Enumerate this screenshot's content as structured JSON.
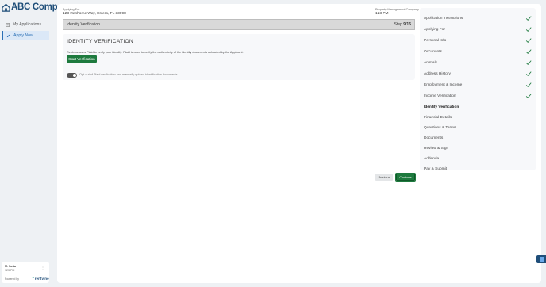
{
  "brand": {
    "logo_text": "ABC Company",
    "accent": "#1f4e79",
    "green": "#1e7a3e"
  },
  "sidebar": {
    "items": [
      {
        "label": "My Applications",
        "icon": "document-icon",
        "active": false
      },
      {
        "label": "Apply Now",
        "icon": "pencil-icon",
        "active": true
      }
    ],
    "user": {
      "name": "M. Sofia",
      "address": "123 PM"
    },
    "powered_by": "Powered by",
    "powered_logo": "rentvine"
  },
  "header": {
    "applying_for_label": "Applying For",
    "applying_for_value": "123 Renhome Way, Estero, FL 33098",
    "company_label": "Property Management Company",
    "company_value": "123 PM"
  },
  "step_bar": {
    "title": "Identity Verification",
    "step_prefix": "Step",
    "step_value": "9/15"
  },
  "verification": {
    "title": "IDENTITY VERIFICATION",
    "description": "Rentvine uses Plaid to verify your identity. Plaid is used to verify the authenticity of the identity documents uploaded by the Applicant.",
    "start_button": "Start Verification",
    "opt_out_label": "Opt-out of Plaid verification and manually upload identification documents"
  },
  "nav_buttons": {
    "previous": "Previous",
    "continue": "Continue"
  },
  "steps": [
    {
      "label": "Application Instructions",
      "done": true
    },
    {
      "label": "Applying For",
      "done": true
    },
    {
      "label": "Personal Info",
      "done": true
    },
    {
      "label": "Occupants",
      "done": true
    },
    {
      "label": "Animals",
      "done": true
    },
    {
      "label": "Address History",
      "done": true
    },
    {
      "label": "Employment & Income",
      "done": true
    },
    {
      "label": "Income Verification",
      "done": true
    },
    {
      "label": "Identity Verification",
      "done": false,
      "current": true
    },
    {
      "label": "Financial Details",
      "done": false
    },
    {
      "label": "Questions & Terms",
      "done": false
    },
    {
      "label": "Documents",
      "done": false
    },
    {
      "label": "Review & Sign",
      "done": false
    },
    {
      "label": "Addenda",
      "done": false
    },
    {
      "label": "Pay & Submit",
      "done": false
    }
  ]
}
